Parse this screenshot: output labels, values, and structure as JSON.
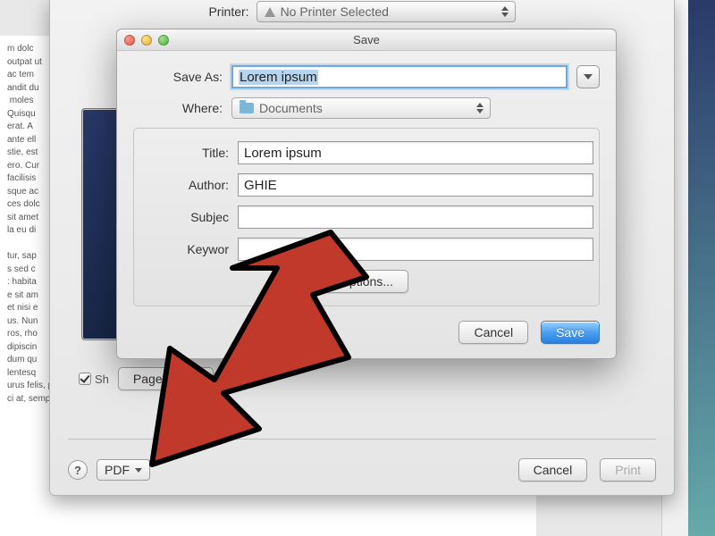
{
  "bg_text": "m dolc\noutpat ut\nac tem\nandit du\n moles\nQuisqu\nerat. A\nante ell\nstie, est\nero. Cur\nfacilisis\nsque ac\nces dolc\nsit amet\nla eu di\n\ntur, sap\ns sed c\n: habita\ne sit am\net nisi e\nus. Nun\nros, rho\ndipiscin\ndum qu\nlentesq\nurus felis, pulvinar ut ligula at, ultricies convallis risus. Mauris elit elit, lacinia\nci at, semper vulputate fe . Nunc at arcu faucibus, ultricies lorem et, tempus",
  "printer": {
    "label": "Printer:",
    "value": "No Printer Selected"
  },
  "print_dialog": {
    "show_checkbox_label": "Sh",
    "page_setup": "Page Setup",
    "help": "?",
    "pdf_label": "PDF",
    "cancel": "Cancel",
    "print": "Print"
  },
  "save_dialog": {
    "title": "Save",
    "save_as_label": "Save As:",
    "save_as_value": "Lorem ipsum",
    "where_label": "Where:",
    "where_value": "Documents",
    "metadata": {
      "title_label": "Title:",
      "title_value": "Lorem ipsum",
      "author_label": "Author:",
      "author_value": "GHIE",
      "subject_label": "Subjec",
      "subject_value": "",
      "keywords_label": "Keywor",
      "keywords_value": "",
      "security_options": "Options..."
    },
    "cancel": "Cancel",
    "save": "Save"
  }
}
